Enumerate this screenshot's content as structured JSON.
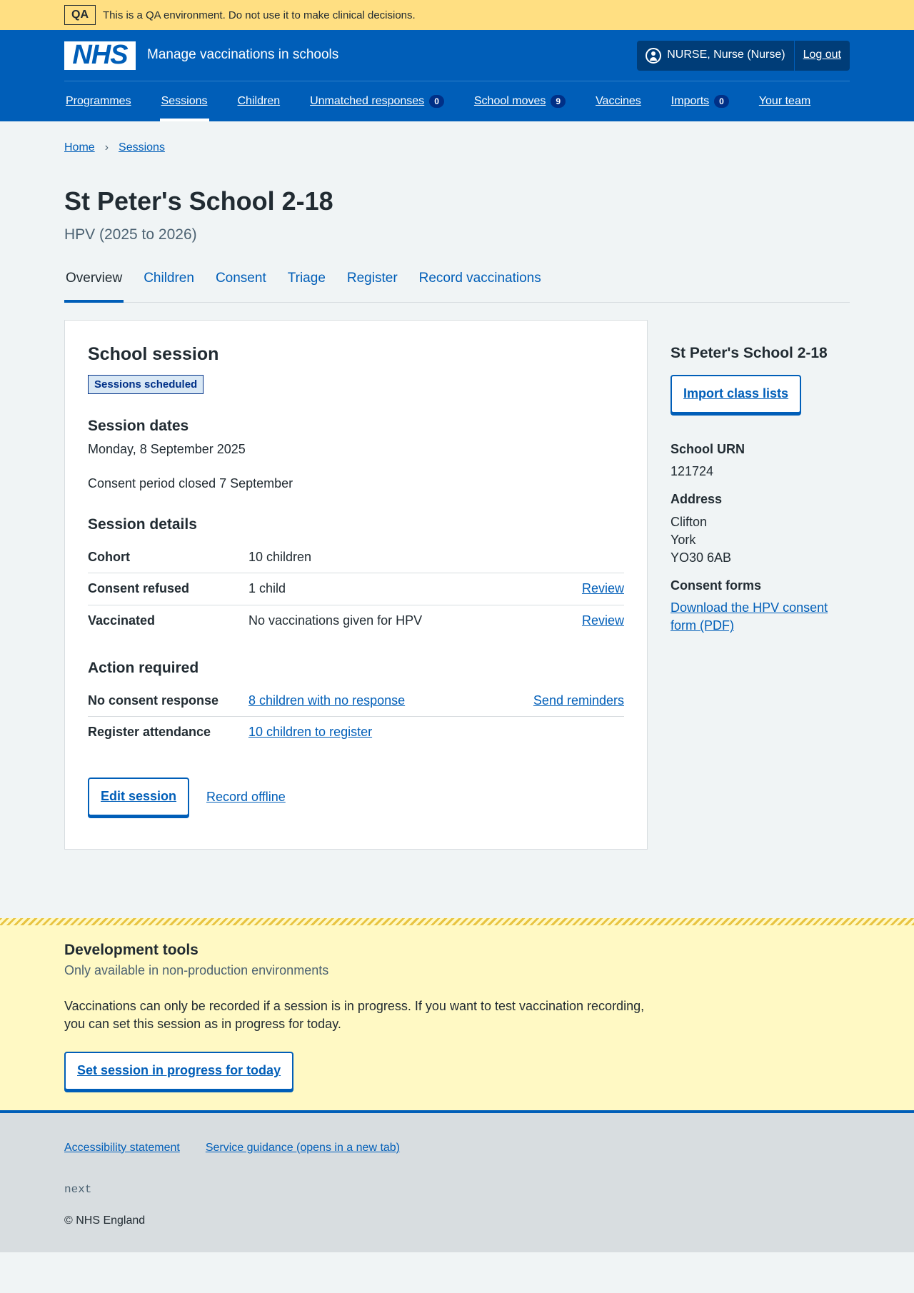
{
  "qa": {
    "tag": "QA",
    "message": "This is a QA environment. Do not use it to make clinical decisions."
  },
  "header": {
    "logo": "NHS",
    "service_name": "Manage vaccinations in schools",
    "user": "NURSE, Nurse (Nurse)",
    "logout": "Log out",
    "nav": [
      {
        "label": "Programmes"
      },
      {
        "label": "Sessions"
      },
      {
        "label": "Children"
      },
      {
        "label": "Unmatched responses",
        "count": "0"
      },
      {
        "label": "School moves",
        "count": "9"
      },
      {
        "label": "Vaccines"
      },
      {
        "label": "Imports",
        "count": "0"
      },
      {
        "label": "Your team"
      }
    ]
  },
  "breadcrumb": [
    "Home",
    "Sessions"
  ],
  "page": {
    "title": "St Peter's School 2-18",
    "caption": "HPV (2025 to 2026)"
  },
  "tabs": [
    "Overview",
    "Children",
    "Consent",
    "Triage",
    "Register",
    "Record vaccinations"
  ],
  "session": {
    "heading": "School session",
    "status": "Sessions scheduled",
    "dates_heading": "Session dates",
    "date": "Monday, 8 September 2025",
    "consent_period": "Consent period closed 7 September",
    "details_heading": "Session details",
    "details": [
      {
        "key": "Cohort",
        "value": "10 children",
        "action": ""
      },
      {
        "key": "Consent refused",
        "value": "1 child",
        "action": "Review"
      },
      {
        "key": "Vaccinated",
        "value": "No vaccinations given for HPV",
        "action": "Review"
      }
    ],
    "action_heading": "Action required",
    "actions_required": [
      {
        "key": "No consent response",
        "value": "8 children with no response",
        "action": "Send reminders"
      },
      {
        "key": "Register attendance",
        "value": "10 children to register",
        "action": ""
      }
    ],
    "edit_button": "Edit session",
    "record_offline": "Record offline"
  },
  "sidebar": {
    "title": "St Peter's School 2-18",
    "import_button": "Import class lists",
    "urn_label": "School URN",
    "urn": "121724",
    "address_label": "Address",
    "address": [
      "Clifton",
      "York",
      "YO30 6AB"
    ],
    "consent_forms_label": "Consent forms",
    "consent_form_link": "Download the HPV consent form (PDF)"
  },
  "dev_tools": {
    "heading": "Development tools",
    "subheading": "Only available in non-production environments",
    "text": "Vaccinations can only be recorded if a session is in progress. If you want to test vaccination recording, you can set this session as in progress for today.",
    "button": "Set session in progress for today"
  },
  "footer": {
    "links": [
      "Accessibility statement",
      "Service guidance (opens in a new tab)"
    ],
    "version": "next",
    "copyright": "© NHS England"
  }
}
